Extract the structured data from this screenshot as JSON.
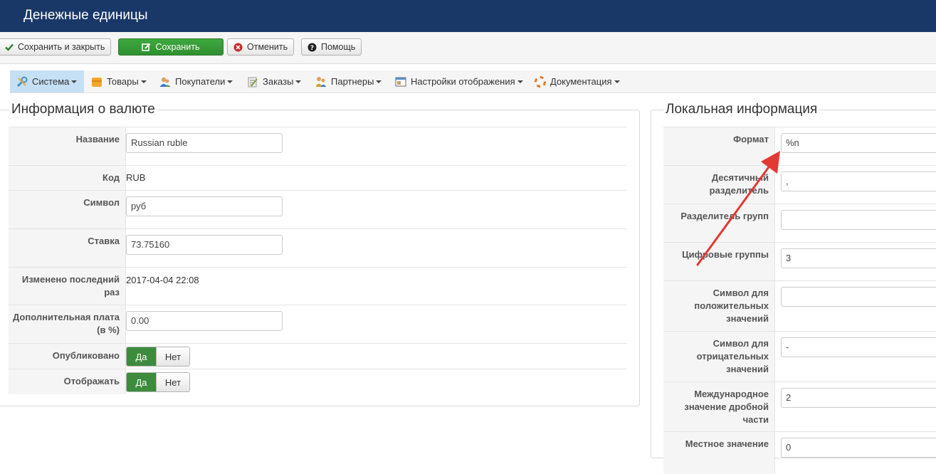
{
  "header": {
    "title": "Денежные единицы"
  },
  "toolbar": {
    "save_close_label": "Сохранить и закрыть",
    "save_label": "Сохранить",
    "cancel_label": "Отменить",
    "help_label": "Помощь"
  },
  "menu": {
    "items": [
      {
        "label": "Система",
        "icon": "wrench-icon"
      },
      {
        "label": "Товары",
        "icon": "box-icon"
      },
      {
        "label": "Покупатели",
        "icon": "users-icon"
      },
      {
        "label": "Заказы",
        "icon": "orders-icon"
      },
      {
        "label": "Партнеры",
        "icon": "partners-icon"
      },
      {
        "label": "Настройки отображения",
        "icon": "display-settings-icon"
      },
      {
        "label": "Документация",
        "icon": "lifebuoy-icon"
      }
    ]
  },
  "currency_panel": {
    "legend": "Информация о валюте",
    "name_label": "Название",
    "name_value": "Russian ruble",
    "code_label": "Код",
    "code_value": "RUB",
    "symbol_label": "Символ",
    "symbol_value": "руб",
    "rate_label": "Ставка",
    "rate_value": "73.75160",
    "modified_label": "Изменено последний раз",
    "modified_value": "2017-04-04 22:08",
    "fee_label": "Дополнительная плата (в %)",
    "fee_value": "0.00",
    "published_label": "Опубликовано",
    "displayed_label": "Отображать",
    "yes": "Да",
    "no": "Нет",
    "published_state": "Да",
    "displayed_state": "Да"
  },
  "locale_panel": {
    "legend": "Локальная информация",
    "format_label": "Формат",
    "format_value": "%n",
    "decimal_sep_label": "Десятичный разделитель",
    "decimal_sep_value": ",",
    "group_sep_label": "Разделитель групп",
    "group_sep_value": "",
    "digit_groups_label": "Цифровые группы",
    "digit_groups_value": "3",
    "positive_sign_label": "Символ для положительных значений",
    "positive_sign_value": "",
    "negative_sign_label": "Символ для отрицательных значений",
    "negative_sign_value": "-",
    "intl_frac_label": "Международное значение дробной части",
    "intl_frac_value": "2",
    "local_frac_label": "Местное значение",
    "local_frac_value": "0"
  },
  "colors": {
    "header_bg": "#1a3867",
    "save_green": "#3ea83e",
    "toggle_on": "#3d8b3d",
    "active_menu": "#c5dff4",
    "annotation_arrow": "#e03a33"
  }
}
